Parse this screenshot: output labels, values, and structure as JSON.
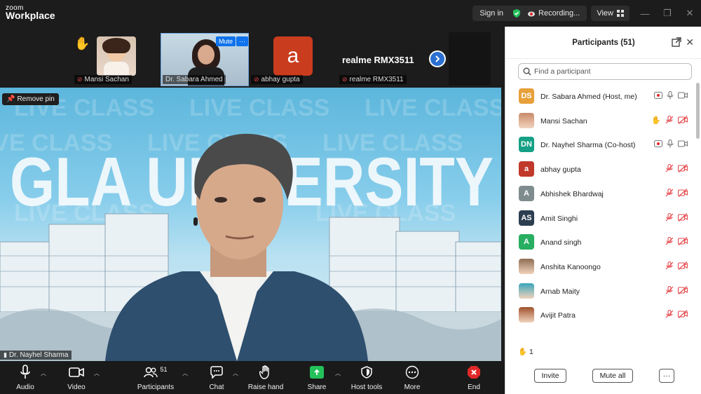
{
  "app": {
    "brand_top": "zoom",
    "brand_bottom": "Workplace"
  },
  "titlebar": {
    "sign_in": "Sign in",
    "recording": "Recording...",
    "view": "View",
    "minimize_icon": "minimize-icon",
    "restore_icon": "restore-icon",
    "close_icon": "close-icon"
  },
  "strip": {
    "tiles": [
      {
        "name": "Mansi Sachan",
        "muted": true
      },
      {
        "name": "Dr. Sabara Ahmed",
        "muted": false,
        "overlay_button": "Mute",
        "overlay_more": "···"
      },
      {
        "name": "abhay gupta",
        "muted": true,
        "avatar_letter": "a"
      },
      {
        "name": "realme RMX3511",
        "muted": true,
        "display_text": "realme RMX3511"
      }
    ],
    "raised_hand_icon": "raised-hand-icon",
    "next_icon": "chevron-right-icon"
  },
  "stage": {
    "remove_pin": "Remove pin",
    "speaker_name": "Dr. Nayhel Sharma",
    "background_text": "GLA UNIVERSITY",
    "watermark_text": "LIVE CLASS"
  },
  "toolbar": {
    "audio": "Audio",
    "video": "Video",
    "participants": "Participants",
    "participants_count": "51",
    "chat": "Chat",
    "raise_hand": "Raise hand",
    "share": "Share",
    "host_tools": "Host tools",
    "more": "More",
    "end": "End"
  },
  "panel": {
    "title": "Participants (51)",
    "search_placeholder": "Find a participant",
    "hand_count": "1",
    "invite": "Invite",
    "mute_all": "Mute all",
    "more": "···",
    "participants": [
      {
        "name": "Dr. Sabara Ahmed (Host, me)",
        "initials": "DS",
        "color": "#e8a13a",
        "mic": "on",
        "rec": true
      },
      {
        "name": "Mansi Sachan",
        "initials": "",
        "color": "#c98b6b",
        "mic": "off",
        "hand": true
      },
      {
        "name": "Dr. Nayhel Sharma (Co-host)",
        "initials": "DN",
        "color": "#16a085",
        "mic": "on",
        "rec": true
      },
      {
        "name": "abhay gupta",
        "initials": "a",
        "color": "#c0392b",
        "mic": "off"
      },
      {
        "name": "Abhishek Bhardwaj",
        "initials": "A",
        "color": "#7f8c8d",
        "mic": "off"
      },
      {
        "name": "Amit Singhi",
        "initials": "AS",
        "color": "#2c3e50",
        "mic": "off"
      },
      {
        "name": "Anand singh",
        "initials": "A",
        "color": "#27ae60",
        "mic": "off"
      },
      {
        "name": "Anshita Kanoongo",
        "initials": "",
        "color": "#8e6e53",
        "mic": "off"
      },
      {
        "name": "Arnab Maity",
        "initials": "",
        "color": "#3aa6b9",
        "mic": "off"
      },
      {
        "name": "Avijit Patra",
        "initials": "",
        "color": "#a0522d",
        "mic": "off"
      }
    ]
  },
  "colors": {
    "muted_red": "#e5484d",
    "share_green": "#23c15a",
    "end_red": "#e02828",
    "link_blue": "#0e72ed"
  }
}
